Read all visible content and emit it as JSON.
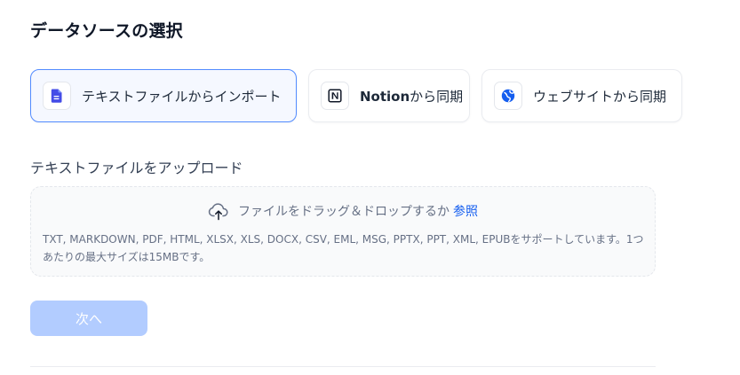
{
  "page": {
    "title": "データソースの選択"
  },
  "sources": [
    {
      "label": "テキストファイルからインポート",
      "icon": "text-file-icon",
      "selected": true
    },
    {
      "label_strong": "Notion",
      "label_rest": "から同期",
      "icon": "notion-icon",
      "selected": false
    },
    {
      "label": "ウェブサイトから同期",
      "icon": "website-icon",
      "selected": false
    }
  ],
  "upload": {
    "section_label": "テキストファイルをアップロード",
    "drop_text": "ファイルをドラッグ＆ドロップするか",
    "browse_label": "参照",
    "supported_text": "TXT, MARKDOWN, PDF, HTML, XLSX, XLS, DOCX, CSV, EML, MSG, PPTX, PPT, XML, EPUBをサポートしています。1つあたりの最大サイズは15MBです。"
  },
  "actions": {
    "next_label": "次へ"
  },
  "colors": {
    "accent": "#155eef",
    "selected_border": "#528bff",
    "selected_bg": "#f5f8ff",
    "disabled_button": "#b2ccff"
  }
}
